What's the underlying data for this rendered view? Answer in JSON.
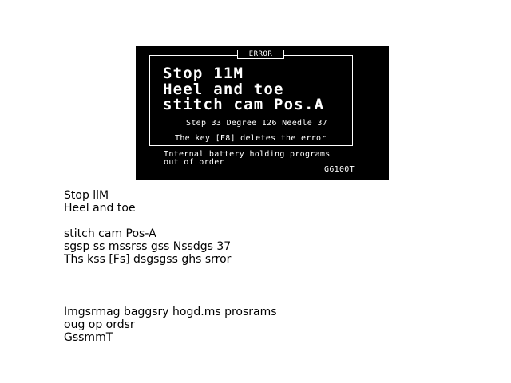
{
  "display": {
    "tab_label": "ERROR",
    "headline": [
      "Stop 11M",
      "Heel and toe",
      "stitch cam Pos.A"
    ],
    "info": "Step 33  Degree 126  Needle 37",
    "hint": "The key [F8] deletes the error",
    "battery": [
      "Internal battery holding programs",
      "out of order"
    ],
    "code": "G6100T"
  },
  "ocr_text": {
    "block_a": [
      "Stop llM",
      "Heel and toe",
      "",
      "stitch cam Pos-A",
      "sgsp ss mssrss gss Nssdgs 37",
      "Ths kss [Fs] dsgsgss ghs srror"
    ],
    "block_b": [
      "Imgsrmag baggsry hogd.ms prosrams",
      "oug op ordsr",
      "GssmmT"
    ]
  }
}
